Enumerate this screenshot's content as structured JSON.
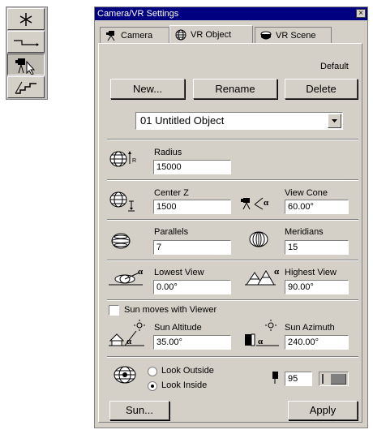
{
  "dialog": {
    "title": "Camera/VR Settings",
    "tabs": [
      "Camera",
      "VR Object",
      "VR Scene"
    ],
    "selected_tab": "VR Object",
    "default_label": "Default",
    "buttons": {
      "new": "New...",
      "rename": "Rename",
      "delete": "Delete",
      "sun": "Sun...",
      "apply": "Apply"
    },
    "object_select": "01  Untitled Object",
    "radius": {
      "label": "Radius",
      "value": "15000"
    },
    "center_z": {
      "label": "Center Z",
      "value": "1500"
    },
    "view_cone": {
      "label": "View Cone",
      "value": "60.00°"
    },
    "parallels": {
      "label": "Parallels",
      "value": "7"
    },
    "meridians": {
      "label": "Meridians",
      "value": "15"
    },
    "lowest_view": {
      "label": "Lowest View",
      "value": "0.00°"
    },
    "highest_view": {
      "label": "Highest View",
      "value": "90.00°"
    },
    "sun_moves": {
      "label": "Sun moves with Viewer",
      "checked": false
    },
    "sun_altitude": {
      "label": "Sun Altitude",
      "value": "35.00°"
    },
    "sun_azimuth": {
      "label": "Sun Azimuth",
      "value": "240.00°"
    },
    "look_outside": "Look Outside",
    "look_inside": "Look Inside",
    "selected_look": "Look Inside",
    "frame_value": "95"
  },
  "colors": {
    "titlebar": "#000080",
    "face": "#d4d0c8"
  }
}
